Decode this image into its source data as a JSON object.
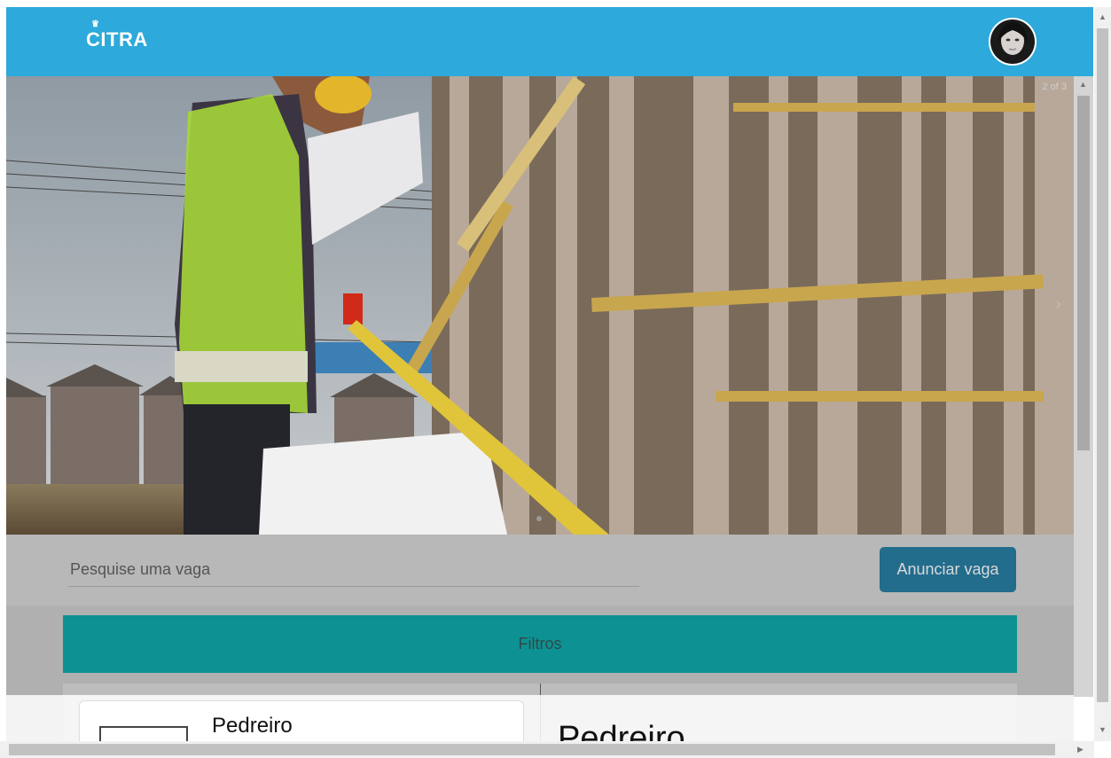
{
  "header": {
    "logo_text": "CITRA",
    "logo_crown": "♛",
    "avatar_icon": "user-avatar"
  },
  "carousel": {
    "counter": "2 of 3",
    "next_arrow": "›"
  },
  "search": {
    "placeholder": "Pesquise uma vaga",
    "announce_label": "Anunciar vaga"
  },
  "filters": {
    "label": "Filtros"
  },
  "listing": {
    "card_title": "Pedreiro",
    "detail_title": "Pedreiro"
  },
  "colors": {
    "header": "#2ea9db",
    "filters_bar": "#0d9192",
    "announce_button": "#226c8c"
  }
}
